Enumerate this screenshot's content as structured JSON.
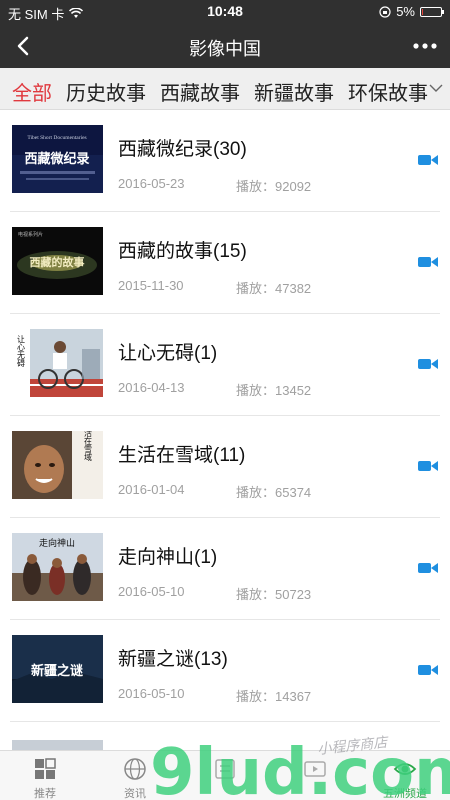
{
  "status": {
    "carrier": "无 SIM 卡",
    "time": "10:48",
    "battery": "5%",
    "battery_level": 0.05
  },
  "nav": {
    "title": "影像中国"
  },
  "tabs": [
    {
      "label": "全部",
      "active": true
    },
    {
      "label": "历史故事",
      "active": false
    },
    {
      "label": "西藏故事",
      "active": false
    },
    {
      "label": "新疆故事",
      "active": false
    },
    {
      "label": "环保故事",
      "active": false
    }
  ],
  "items": [
    {
      "title": "西藏微纪录(30)",
      "date": "2016-05-23",
      "plays": "播放：92092",
      "thumb_text": "西藏微纪录",
      "thumb_caption": "Tibet Short Documentaries"
    },
    {
      "title": "西藏的故事(15)",
      "date": "2015-11-30",
      "plays": "播放：47382",
      "thumb_text": "西藏的故事",
      "thumb_caption": "电视系列片"
    },
    {
      "title": "让心无碍(1)",
      "date": "2016-04-13",
      "plays": "播放：13452",
      "thumb_text": "让心无碍",
      "thumb_caption": ""
    },
    {
      "title": "生活在雪域(11)",
      "date": "2016-01-04",
      "plays": "播放：65374",
      "thumb_text": "生活在雪域",
      "thumb_caption": ""
    },
    {
      "title": "走向神山(1)",
      "date": "2016-05-10",
      "plays": "播放：50723",
      "thumb_text": "走向神山",
      "thumb_caption": ""
    },
    {
      "title": "新疆之谜(13)",
      "date": "2016-05-10",
      "plays": "播放：14367",
      "thumb_text": "新疆之谜",
      "thumb_caption": ""
    }
  ],
  "tabbar": [
    {
      "label": "推荐",
      "icon": "grid-icon",
      "active": false
    },
    {
      "label": "资讯",
      "icon": "globe-icon",
      "active": false
    },
    {
      "label": "",
      "icon": "list-icon",
      "active": false
    },
    {
      "label": "",
      "icon": "video-icon",
      "active": false
    },
    {
      "label": "五洲频道",
      "icon": "eye-icon",
      "active": true
    }
  ],
  "watermark": {
    "text": "9lud.com",
    "handwriting": "小程序商店"
  },
  "colors": {
    "bar_bg": "#303030",
    "accent_red": "#e0393e",
    "video_icon": "#1f8fe0",
    "active_green": "#2aa84a",
    "watermark_green": "#3fd07e"
  }
}
